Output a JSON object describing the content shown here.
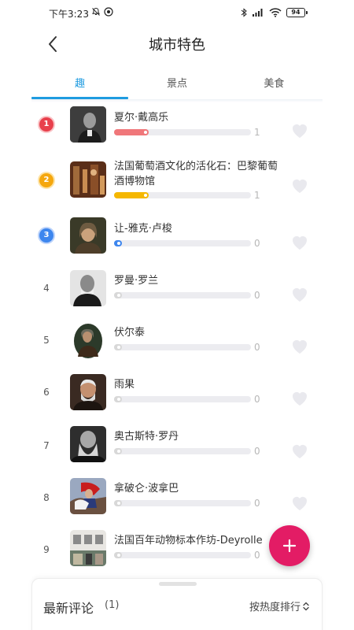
{
  "status_bar": {
    "time": "下午3:23",
    "battery": "94",
    "icons": [
      "mute-icon",
      "app-notification-icon",
      "bluetooth-icon",
      "signal-icon",
      "wifi-icon",
      "battery-icon"
    ]
  },
  "header": {
    "title": "城市特色",
    "back_icon": "back-arrow-icon"
  },
  "tabs": [
    {
      "label": "趣",
      "active": true
    },
    {
      "label": "景点",
      "active": false
    },
    {
      "label": "美食",
      "active": false
    }
  ],
  "colors": {
    "accent": "#1e9be0",
    "rank1": "#e8404c",
    "rank2": "#f5a70e",
    "rank3": "#3d86ee",
    "bar_red": "#f0777a",
    "bar_yellow": "#f5b700",
    "bar_blue": "#3d86ee",
    "bar_gray": "#d8d8d8",
    "fab": "#e31c65"
  },
  "items": [
    {
      "rank": "1",
      "name": "夏尔·戴高乐",
      "count": "1",
      "fill_fraction": 0.25
    },
    {
      "rank": "2",
      "name": "法国葡萄酒文化的活化石：巴黎葡萄酒博物馆",
      "count": "1",
      "fill_fraction": 0.25
    },
    {
      "rank": "3",
      "name": "让-雅克·卢梭",
      "count": "0",
      "fill_fraction": 0.0
    },
    {
      "rank": "4",
      "name": "罗曼·罗兰",
      "count": "0",
      "fill_fraction": 0.0
    },
    {
      "rank": "5",
      "name": "伏尔泰",
      "count": "0",
      "fill_fraction": 0.0
    },
    {
      "rank": "6",
      "name": "雨果",
      "count": "0",
      "fill_fraction": 0.0
    },
    {
      "rank": "7",
      "name": "奥古斯特·罗丹",
      "count": "0",
      "fill_fraction": 0.0
    },
    {
      "rank": "8",
      "name": "拿破仑·波拿巴",
      "count": "0",
      "fill_fraction": 0.0
    },
    {
      "rank": "9",
      "name": "法国百年动物标本作坊-Deyrolle",
      "count": "0",
      "fill_fraction": 0.0
    }
  ],
  "fab": {
    "icon": "plus-icon"
  },
  "comments": {
    "title": "最新评论",
    "count": "(1)",
    "sort_label": "按热度排行",
    "sort_icon": "sort-updown-icon"
  }
}
